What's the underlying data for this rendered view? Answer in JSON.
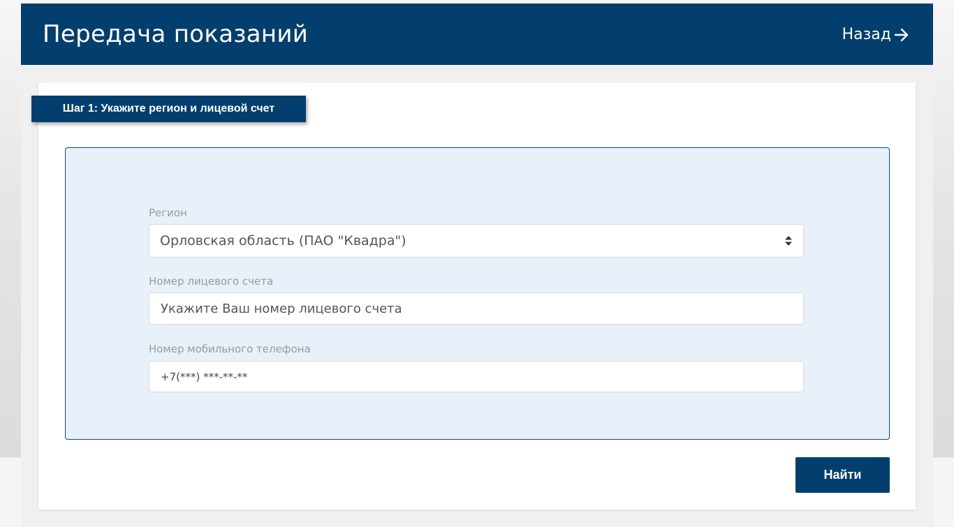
{
  "header": {
    "title": "Передача показаний",
    "back_label": "Назад",
    "back_icon": "arrow-right-icon"
  },
  "colors": {
    "brand": "#033f6e",
    "panel_background": "#e8f0f9"
  },
  "step": {
    "label": "Шаг 1: Укажите регион и лицевой счет"
  },
  "form": {
    "region": {
      "label": "Регион",
      "value": "Орловская область (ПАО \"Квадра\")",
      "icon": "sort-arrows-icon"
    },
    "account": {
      "label": "Номер лицевого счета",
      "placeholder": "Укажите Ваш номер лицевого счета"
    },
    "phone": {
      "label": "Номер мобильного телефона",
      "placeholder": "+7(***) ***-**-**"
    }
  },
  "actions": {
    "find_label": "Найти"
  }
}
